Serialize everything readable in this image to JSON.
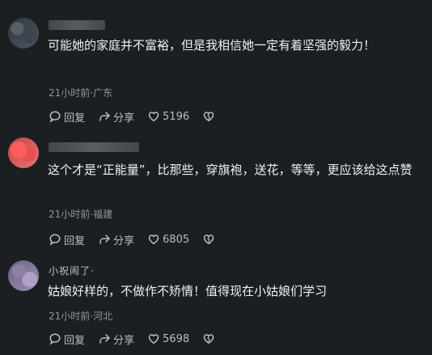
{
  "comments": [
    {
      "text": "可能她的家庭并不富裕，但是我相信她一定有着坚强的毅力！",
      "meta": "21小时前·广东",
      "reply": "回复",
      "share": "分享",
      "likes": "5196"
    },
    {
      "text": "这个才是“正能量”，比那些，穿旗袍，送花，等等，更应该给这点赞",
      "meta": "21小时前·福建",
      "reply": "回复",
      "share": "分享",
      "likes": "6805"
    },
    {
      "name_fragment": "小祝闹了·",
      "text": "姑娘好样的，不做作不矫情！值得现在小姑娘们学习",
      "meta": "21小时前·河北",
      "reply": "回复",
      "share": "分享",
      "likes": "5698"
    }
  ],
  "icons": {
    "reply": "speech-bubble-icon",
    "share": "share-arrow-icon",
    "like": "heart-icon",
    "dislike": "broken-heart-icon"
  }
}
